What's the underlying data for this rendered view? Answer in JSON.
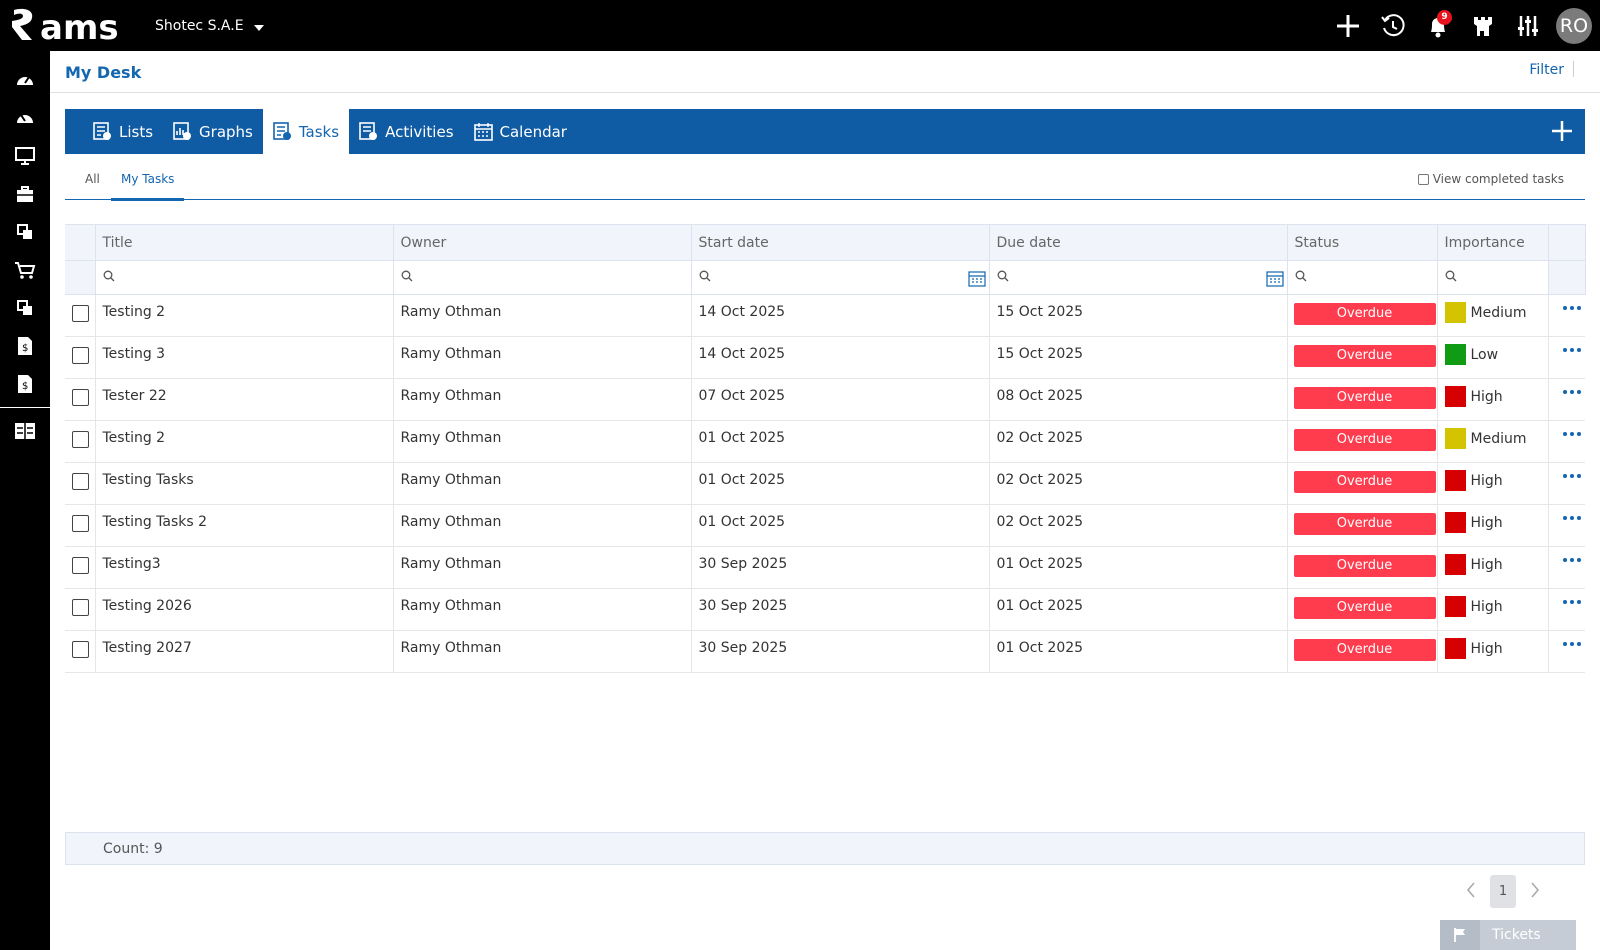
{
  "app": {
    "logo_text": "ams",
    "company": "Shotec S.A.E",
    "notifications_count": "9",
    "avatar_initials": "RO"
  },
  "header": {
    "title": "My Desk",
    "filter_label": "Filter"
  },
  "tabs": [
    {
      "label": "Lists",
      "icon": "list-icon"
    },
    {
      "label": "Graphs",
      "icon": "graph-icon"
    },
    {
      "label": "Tasks",
      "icon": "tasks-icon",
      "active": true
    },
    {
      "label": "Activities",
      "icon": "activities-icon"
    },
    {
      "label": "Calendar",
      "icon": "calendar-icon"
    }
  ],
  "subtabs": {
    "all": "All",
    "my_tasks": "My Tasks",
    "view_completed": "View completed tasks"
  },
  "table": {
    "columns": [
      "Title",
      "Owner",
      "Start date",
      "Due date",
      "Status",
      "Importance"
    ],
    "rows": [
      {
        "title": "Testing 2",
        "owner": "Ramy Othman",
        "start": "14 Oct 2025",
        "due": "15 Oct 2025",
        "status": "Overdue",
        "importance": "Medium",
        "imp_color": "#d4c400"
      },
      {
        "title": "Testing 3",
        "owner": "Ramy Othman",
        "start": "14 Oct 2025",
        "due": "15 Oct 2025",
        "status": "Overdue",
        "importance": "Low",
        "imp_color": "#0f9b14"
      },
      {
        "title": "Tester 22",
        "owner": "Ramy Othman",
        "start": "07 Oct 2025",
        "due": "08 Oct 2025",
        "status": "Overdue",
        "importance": "High",
        "imp_color": "#d60000"
      },
      {
        "title": "Testing 2",
        "owner": "Ramy Othman",
        "start": "01 Oct 2025",
        "due": "02 Oct 2025",
        "status": "Overdue",
        "importance": "Medium",
        "imp_color": "#d4c400"
      },
      {
        "title": "Testing Tasks",
        "owner": "Ramy Othman",
        "start": "01 Oct 2025",
        "due": "02 Oct 2025",
        "status": "Overdue",
        "importance": "High",
        "imp_color": "#d60000"
      },
      {
        "title": "Testing Tasks 2",
        "owner": "Ramy Othman",
        "start": "01 Oct 2025",
        "due": "02 Oct 2025",
        "status": "Overdue",
        "importance": "High",
        "imp_color": "#d60000"
      },
      {
        "title": "Testing3",
        "owner": "Ramy Othman",
        "start": "30 Sep 2025",
        "due": "01 Oct 2025",
        "status": "Overdue",
        "importance": "High",
        "imp_color": "#d60000"
      },
      {
        "title": "Testing 2026",
        "owner": "Ramy Othman",
        "start": "30 Sep 2025",
        "due": "01 Oct 2025",
        "status": "Overdue",
        "importance": "High",
        "imp_color": "#d60000"
      },
      {
        "title": "Testing 2027",
        "owner": "Ramy Othman",
        "start": "30 Sep 2025",
        "due": "01 Oct 2025",
        "status": "Overdue",
        "importance": "High",
        "imp_color": "#d60000"
      }
    ]
  },
  "footer": {
    "count_label": "Count: 9",
    "current_page": "1",
    "tickets_label": "Tickets"
  },
  "colors": {
    "accent": "#0f5ba4",
    "link": "#1366b0",
    "overdue": "#ff3b4e"
  }
}
